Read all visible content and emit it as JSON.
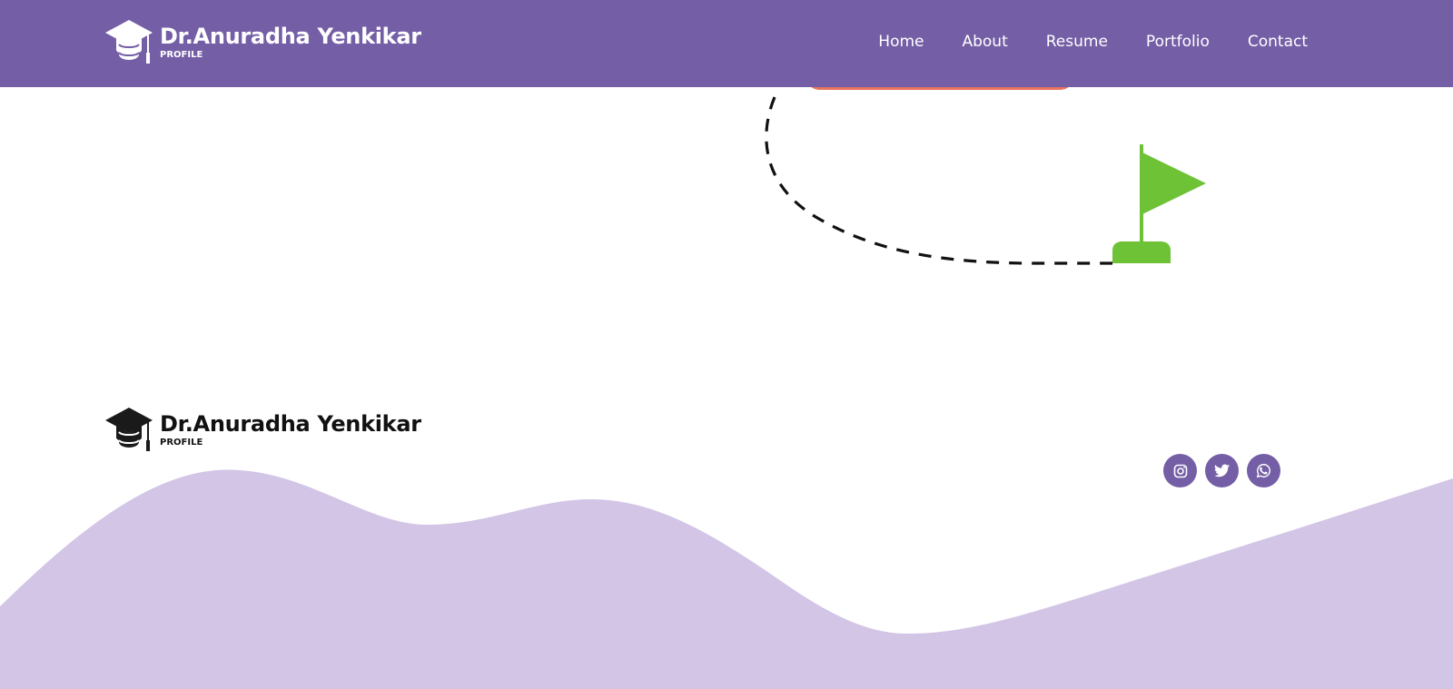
{
  "header": {
    "brand": {
      "name": "Dr.Anuradha Yenkikar",
      "subtitle": "PROFILE",
      "logo_icon": "graduation-cap-icon"
    },
    "nav": [
      {
        "label": "Home"
      },
      {
        "label": "About"
      },
      {
        "label": "Resume"
      },
      {
        "label": "Portfolio"
      },
      {
        "label": "Contact"
      }
    ],
    "background_color": "#745ea6"
  },
  "illustration": {
    "path_style": "dashed",
    "flag_icon": "goal-flag-icon",
    "flag_color": "#6dc235",
    "accent_color": "#e8735f"
  },
  "footer": {
    "brand": {
      "name": "Dr.Anuradha Yenkikar",
      "subtitle": "PROFILE",
      "logo_icon": "graduation-cap-icon"
    },
    "social": [
      {
        "icon": "instagram-icon"
      },
      {
        "icon": "twitter-icon"
      },
      {
        "icon": "whatsapp-icon"
      }
    ],
    "wave_color": "#d3c5e6",
    "accent_color": "#745ea6"
  }
}
